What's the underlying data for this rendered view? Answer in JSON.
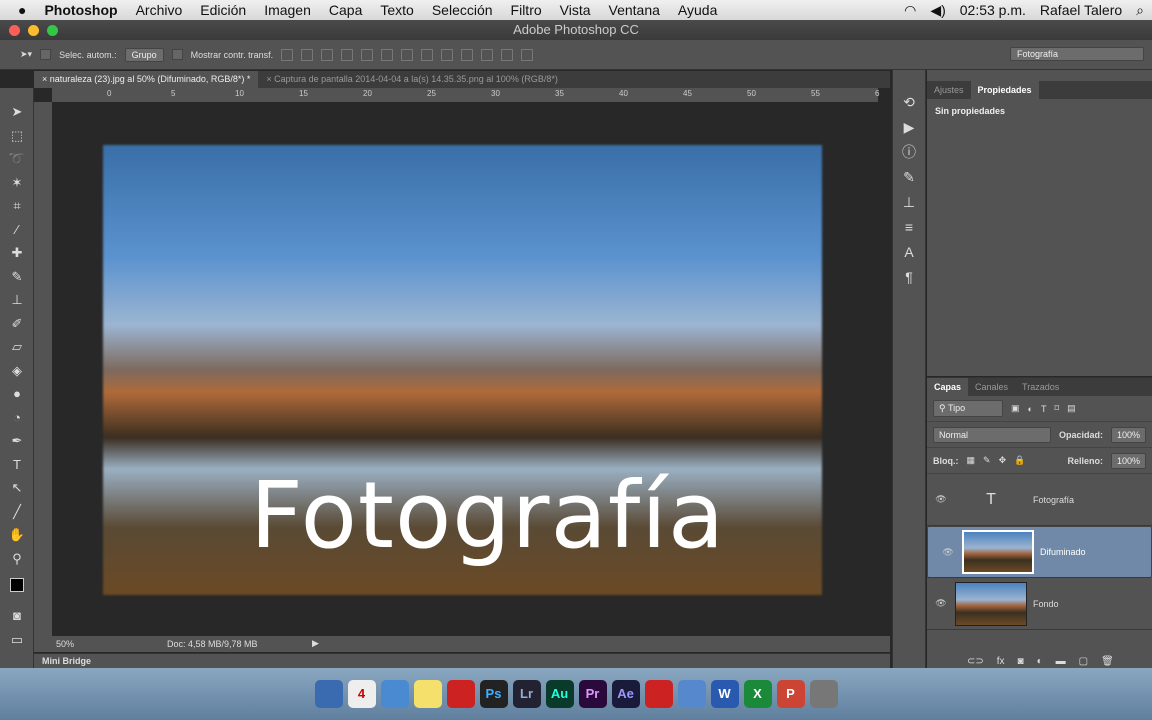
{
  "menubar": {
    "apple": "",
    "app": "Photoshop",
    "items": [
      "Archivo",
      "Edición",
      "Imagen",
      "Capa",
      "Texto",
      "Selección",
      "Filtro",
      "Vista",
      "Ventana",
      "Ayuda"
    ],
    "time": "02:53 p.m.",
    "user": "Rafael Talero"
  },
  "window": {
    "title": "Adobe Photoshop CC"
  },
  "options": {
    "auto_select": "Selec. autom.:",
    "group": "Grupo",
    "show_transform": "Mostrar contr. transf.",
    "workspace": "Fotografía"
  },
  "tabs": [
    {
      "label": "naturaleza (23).jpg al 50% (Difuminado, RGB/8*) *"
    },
    {
      "label": "Captura de pantalla 2014-04-04 a la(s) 14.35.35.png al 100% (RGB/8*)"
    }
  ],
  "ruler": [
    "0",
    "5",
    "10",
    "15",
    "20",
    "25",
    "30",
    "35",
    "40",
    "45",
    "50",
    "55",
    "6"
  ],
  "canvas": {
    "text": "Fotografía"
  },
  "status": {
    "zoom": "50%",
    "doc": "Doc: 4,58 MB/9,78 MB"
  },
  "minibridge": "Mini Bridge",
  "properties": {
    "tabs": [
      "Ajustes",
      "Propiedades"
    ],
    "active": 1,
    "content": "Sin propiedades"
  },
  "layers_panel": {
    "tabs": [
      "Capas",
      "Canales",
      "Trazados"
    ],
    "filter": "Tipo",
    "blend": "Normal",
    "opacity_label": "Opacidad:",
    "opacity": "100%",
    "lock_label": "Bloq.:",
    "fill_label": "Relleno:",
    "fill": "100%",
    "layers": [
      {
        "name": "Fotografía",
        "type": "text",
        "selected": false
      },
      {
        "name": "Difuminado",
        "type": "image",
        "selected": true
      },
      {
        "name": "Fondo",
        "type": "image",
        "selected": false
      }
    ]
  },
  "dock": [
    "Ps",
    "Lr",
    "Au",
    "Pr",
    "Ae"
  ]
}
